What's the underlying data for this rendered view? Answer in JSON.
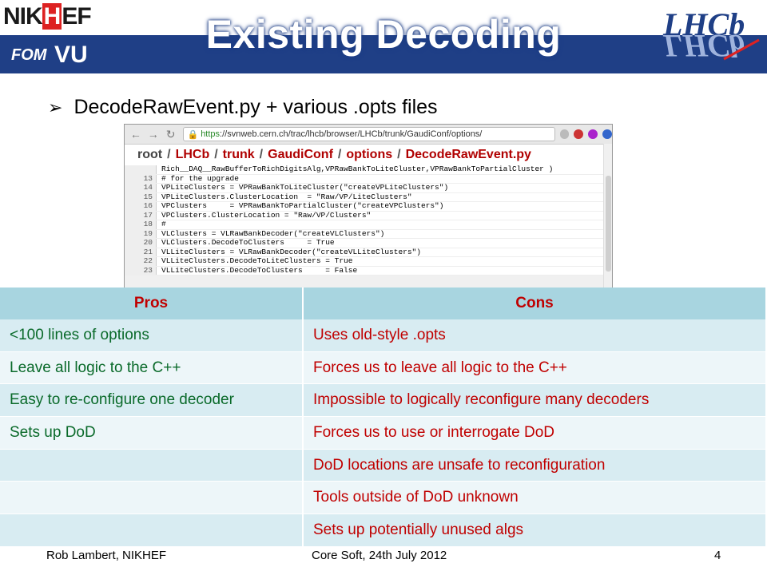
{
  "slide": {
    "title": "Existing Decoding",
    "bullet": "DecodeRawEvent.py + various .opts files"
  },
  "logos": {
    "nikhef_pre": "NIK",
    "nikhef_h": "H",
    "nikhef_post": "EF",
    "fom": "FOM",
    "vu": "VU",
    "lhcb": "LHCb"
  },
  "browser": {
    "url_prefix": "https",
    "url_rest": "://svnweb.cern.ch/trac/lhcb/browser/LHCb/trunk/GaudiConf/options/",
    "breadcrumbs": [
      "root",
      "LHCb",
      "trunk",
      "GaudiConf",
      "options",
      "DecodeRawEvent.py"
    ],
    "code_lines": [
      {
        "n": "",
        "text": "Rich__DAQ__RawBufferToRichDigitsAlg,VPRawBankToLiteCluster,VPRawBankToPartialCluster )"
      },
      {
        "n": "13",
        "text": "# for the upgrade"
      },
      {
        "n": "14",
        "text": "VPLiteClusters = VPRawBankToLiteCluster(\"createVPLiteClusters\")"
      },
      {
        "n": "15",
        "text": "VPLiteClusters.ClusterLocation  = \"Raw/VP/LiteClusters\""
      },
      {
        "n": "16",
        "text": "VPClusters     = VPRawBankToPartialCluster(\"createVPClusters\")"
      },
      {
        "n": "17",
        "text": "VPClusters.ClusterLocation = \"Raw/VP/Clusters\""
      },
      {
        "n": "18",
        "text": "#"
      },
      {
        "n": "19",
        "text": "VLClusters = VLRawBankDecoder(\"createVLClusters\")"
      },
      {
        "n": "20",
        "text": "VLClusters.DecodeToClusters     = True"
      },
      {
        "n": "21",
        "text": "VLLiteClusters = VLRawBankDecoder(\"createVLLiteClusters\")"
      },
      {
        "n": "22",
        "text": "VLLiteClusters.DecodeToLiteClusters = True"
      },
      {
        "n": "23",
        "text": "VLLiteClusters.DecodeToClusters     = False"
      }
    ]
  },
  "table": {
    "headers": [
      "Pros",
      "Cons"
    ],
    "rows": [
      {
        "pro": "<100 lines of options",
        "con": "Uses old-style .opts"
      },
      {
        "pro": "Leave all logic to the C++",
        "con": "Forces us to leave all logic to the C++"
      },
      {
        "pro": "Easy to re-configure one decoder",
        "con": "Impossible to logically reconfigure many decoders"
      },
      {
        "pro": "Sets up DoD",
        "con": "Forces us to use or interrogate DoD"
      },
      {
        "pro": "",
        "con": "DoD locations are unsafe to reconfiguration"
      },
      {
        "pro": "",
        "con": "Tools outside of DoD unknown"
      },
      {
        "pro": "",
        "con": "Sets up potentially unused algs"
      }
    ]
  },
  "footer": {
    "author": "Rob Lambert, NIKHEF",
    "event": "Core Soft, 24th July 2012",
    "page": "4"
  },
  "colors": {
    "header_band": "#1f3f86",
    "table_header": "#a8d5e0",
    "pros_text": "#0a6a2a",
    "cons_text": "#c00000"
  }
}
